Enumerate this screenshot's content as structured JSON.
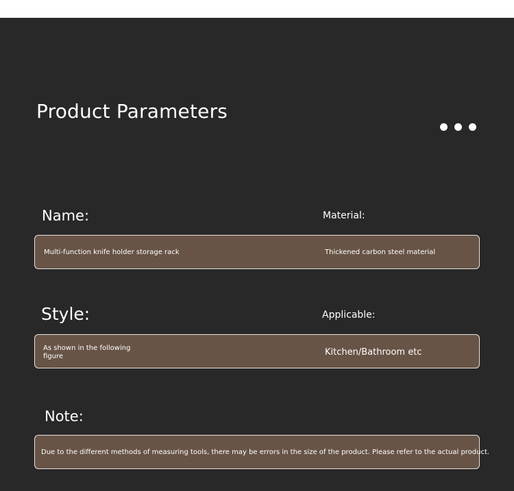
{
  "header": {
    "title": "Product Parameters",
    "more_icon": "more-dots-icon"
  },
  "params": {
    "name": {
      "label": "Name:",
      "value": "Multi-function knife holder storage rack"
    },
    "material": {
      "label": "Material:",
      "value": "Thickened carbon steel material"
    },
    "style": {
      "label": "Style:",
      "value": "As shown in the following figure"
    },
    "applicable": {
      "label": "Applicable:",
      "value": "Kitchen/Bathroom etc"
    },
    "note": {
      "label": "Note:",
      "value": "Due to the different methods of measuring tools, there may be errors in the size of the product. Please refer to the actual product."
    }
  },
  "colors": {
    "panel_bg": "#282828",
    "box_bg": "#675446",
    "box_border": "#e8e3df",
    "text": "#ffffff"
  }
}
